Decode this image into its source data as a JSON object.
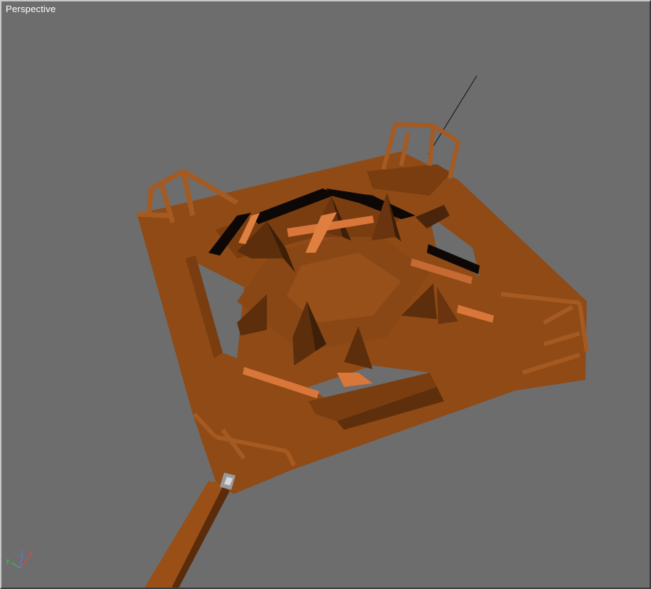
{
  "viewport": {
    "label": "Perspective"
  },
  "axis_gizmo": {
    "y_label": "Y",
    "z_label": "Z",
    "x_label": "X"
  },
  "colors": {
    "background": "#6d6d6d",
    "model_base": "#8b4513",
    "model_light": "#d9763a",
    "model_dark": "#4a250c",
    "axis_x": "#ff3b3b",
    "axis_y": "#3bcc3b",
    "axis_z": "#4a7bff"
  }
}
